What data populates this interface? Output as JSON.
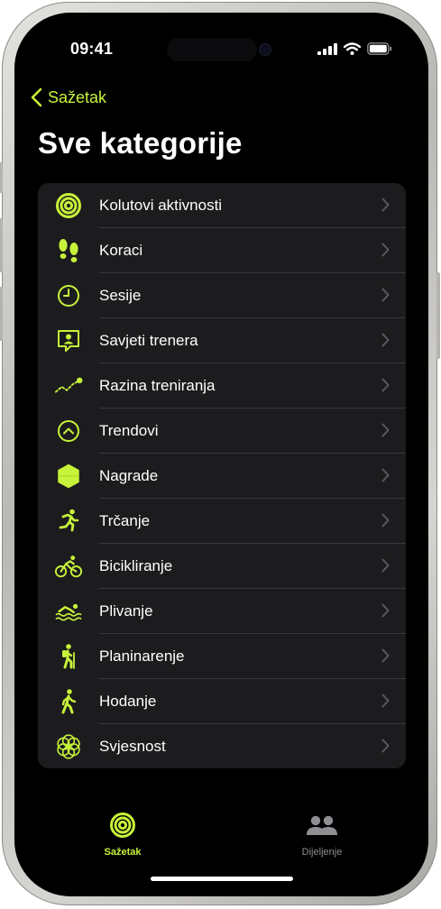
{
  "status_bar": {
    "time": "09:41"
  },
  "nav": {
    "back_label": "Sažetak"
  },
  "page": {
    "title": "Sve kategorije"
  },
  "accent_color": "#c7f33a",
  "categories": [
    {
      "label": "Kolutovi aktivnosti",
      "icon": "activity-rings-icon"
    },
    {
      "label": "Koraci",
      "icon": "footprints-icon"
    },
    {
      "label": "Sesije",
      "icon": "clock-icon"
    },
    {
      "label": "Savjeti trenera",
      "icon": "coach-icon"
    },
    {
      "label": "Razina treniranja",
      "icon": "training-load-icon"
    },
    {
      "label": "Trendovi",
      "icon": "trends-icon"
    },
    {
      "label": "Nagrade",
      "icon": "awards-icon"
    },
    {
      "label": "Trčanje",
      "icon": "running-icon"
    },
    {
      "label": "Bicikliranje",
      "icon": "cycling-icon"
    },
    {
      "label": "Plivanje",
      "icon": "swimming-icon"
    },
    {
      "label": "Planinarenje",
      "icon": "hiking-icon"
    },
    {
      "label": "Hodanje",
      "icon": "walking-icon"
    },
    {
      "label": "Svjesnost",
      "icon": "mindfulness-icon"
    }
  ],
  "tab_bar": {
    "summary_label": "Sažetak",
    "sharing_label": "Dijeljenje"
  }
}
